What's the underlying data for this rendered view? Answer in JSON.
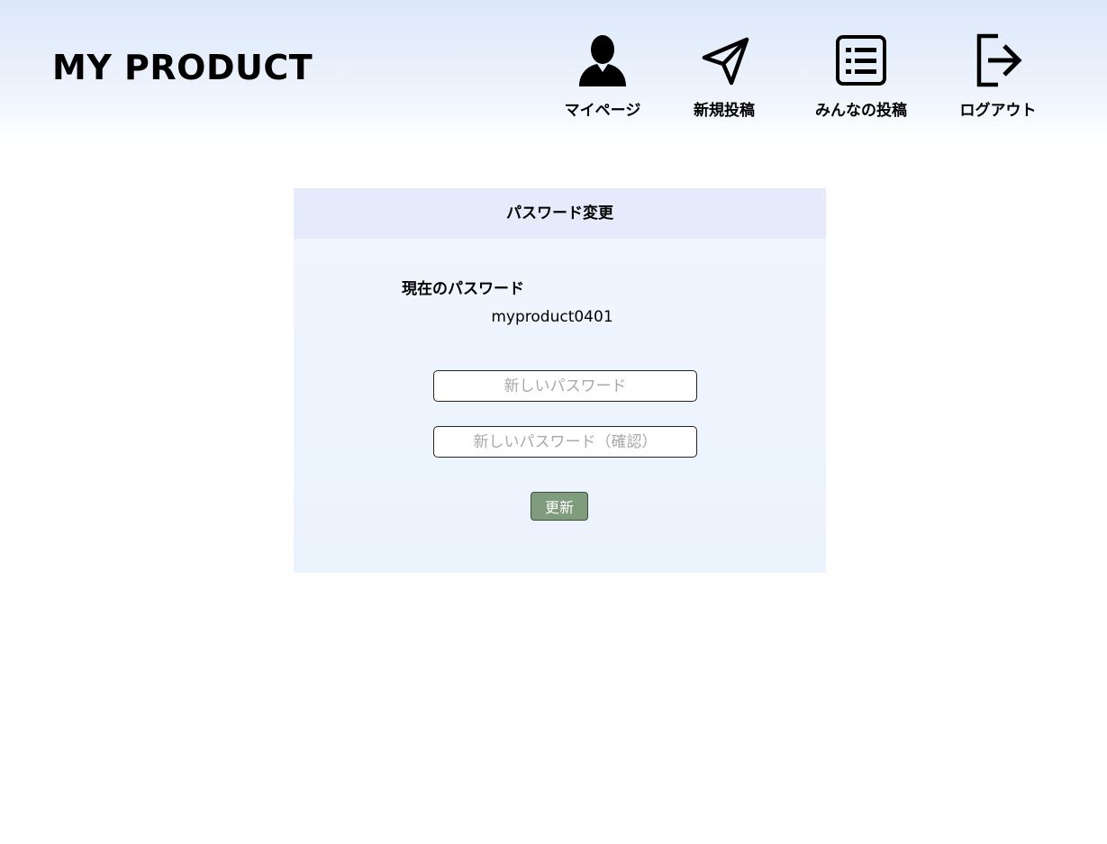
{
  "header": {
    "logo": "MY PRODUCT",
    "nav": [
      {
        "label": "マイページ",
        "icon": "user-icon"
      },
      {
        "label": "新規投稿",
        "icon": "send-icon"
      },
      {
        "label": "みんなの投稿",
        "icon": "list-icon"
      },
      {
        "label": "ログアウト",
        "icon": "logout-icon"
      }
    ]
  },
  "form": {
    "title": "パスワード変更",
    "current_label": "現在のパスワード",
    "current_value": "myproduct0401",
    "new_password_placeholder": "新しいパスワード",
    "confirm_password_placeholder": "新しいパスワード（確認）",
    "submit_label": "更新"
  },
  "colors": {
    "header_top": "#dbe7f9",
    "card_header": "#e6ebfb",
    "card_body": "#eef4fd",
    "button": "#7f9c7c"
  }
}
